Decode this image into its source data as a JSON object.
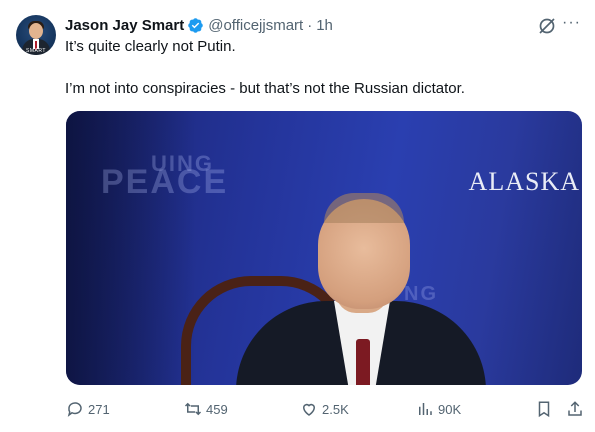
{
  "tweet": {
    "author_name": "Jason Jay Smart",
    "handle": "@officejjsmart",
    "separator": "·",
    "time": "1h",
    "more": "···",
    "avatar_caption": "SMART",
    "text_line1": "It’s quite clearly not Putin.",
    "text_line2": "I’m not into conspiracies - but that’s not the Russian dictator."
  },
  "media": {
    "backdrop_word1": "UING",
    "backdrop_word2": "PEACE",
    "backdrop_word3": "NG",
    "backdrop_location": "ALASKA"
  },
  "actions": {
    "replies": "271",
    "reposts": "459",
    "likes": "2.5K",
    "views": "90K"
  },
  "colors": {
    "verified_blue": "#1d9bf0",
    "secondary_text": "#536471",
    "backdrop_blue": "#24349a"
  },
  "icons": [
    "verified-icon",
    "grok-icon",
    "more-icon",
    "reply-icon",
    "repost-icon",
    "like-icon",
    "views-icon",
    "bookmark-icon",
    "share-icon"
  ]
}
